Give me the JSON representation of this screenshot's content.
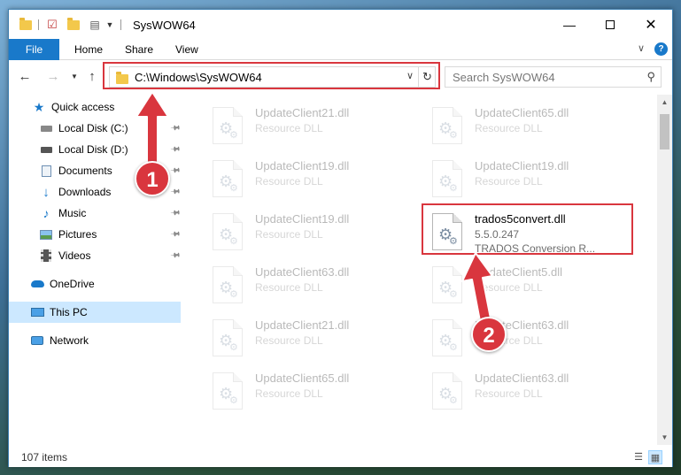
{
  "window": {
    "title": "SysWOW64",
    "minimize_icon": "minimize-icon",
    "maximize_icon": "maximize-icon",
    "close_icon": "close-icon"
  },
  "ribbon": {
    "tabs": [
      "File",
      "Home",
      "Share",
      "View"
    ]
  },
  "navbar": {
    "address": "C:\\Windows\\SysWOW64",
    "search_placeholder": "Search SysWOW64"
  },
  "sidebar": {
    "items": [
      {
        "label": "Quick access",
        "icon": "star-icon"
      },
      {
        "label": "Local Disk (C:)",
        "icon": "drive-icon"
      },
      {
        "label": "Local Disk (D:)",
        "icon": "drive-icon"
      },
      {
        "label": "Documents",
        "icon": "documents-icon"
      },
      {
        "label": "Downloads",
        "icon": "download-icon"
      },
      {
        "label": "Music",
        "icon": "music-icon"
      },
      {
        "label": "Pictures",
        "icon": "pictures-icon"
      },
      {
        "label": "Videos",
        "icon": "videos-icon"
      },
      {
        "label": "OneDrive",
        "icon": "cloud-icon"
      },
      {
        "label": "This PC",
        "icon": "computer-icon"
      },
      {
        "label": "Network",
        "icon": "network-icon"
      }
    ]
  },
  "files": {
    "left": [
      {
        "name": "UpdateClient21.dll",
        "type": "Resource DLL"
      },
      {
        "name": "UpdateClient19.dll",
        "type": "Resource DLL"
      },
      {
        "name": "UpdateClient19.dll",
        "type": "Resource DLL"
      },
      {
        "name": "UpdateClient63.dll",
        "type": "Resource DLL"
      },
      {
        "name": "UpdateClient21.dll",
        "type": "Resource DLL"
      },
      {
        "name": "UpdateClient65.dll",
        "type": "Resource DLL"
      }
    ],
    "right": [
      {
        "name": "UpdateClient65.dll",
        "type": "Resource DLL"
      },
      {
        "name": "UpdateClient19.dll",
        "type": "Resource DLL"
      },
      {
        "name": "trados5convert.dll",
        "version": "5.5.0.247",
        "type": "TRADOS Conversion R..."
      },
      {
        "name": "UpdateClient5.dll",
        "type": "Resource DLL"
      },
      {
        "name": "UpdateClient63.dll",
        "type": "Resource DLL"
      },
      {
        "name": "UpdateClient63.dll",
        "type": "Resource DLL"
      }
    ]
  },
  "status": {
    "count": "107 items"
  },
  "annotations": {
    "badge1": "1",
    "badge2": "2",
    "color": "#d9363e"
  }
}
